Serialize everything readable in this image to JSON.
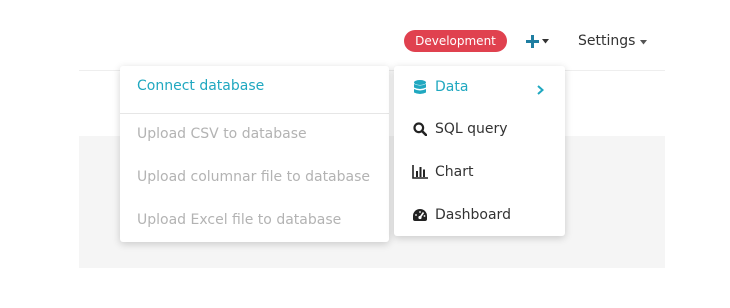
{
  "header": {
    "environment_badge": "Development",
    "settings_label": "Settings"
  },
  "colors": {
    "accent": "#20a8c0",
    "badge": "#e0414f",
    "disabled_text": "#b3b3b3"
  },
  "plus_menu": {
    "items": [
      {
        "label": "Data",
        "icon": "database-icon",
        "active": true,
        "has_submenu": true
      },
      {
        "label": "SQL query",
        "icon": "search-icon"
      },
      {
        "label": "Chart",
        "icon": "bar-chart-icon"
      },
      {
        "label": "Dashboard",
        "icon": "dashboard-gauge-icon"
      }
    ]
  },
  "data_submenu": {
    "items": [
      {
        "label": "Connect database",
        "enabled": true
      },
      {
        "label": "Upload CSV to database",
        "enabled": false
      },
      {
        "label": "Upload columnar file to database",
        "enabled": false
      },
      {
        "label": "Upload Excel file to database",
        "enabled": false
      }
    ]
  }
}
